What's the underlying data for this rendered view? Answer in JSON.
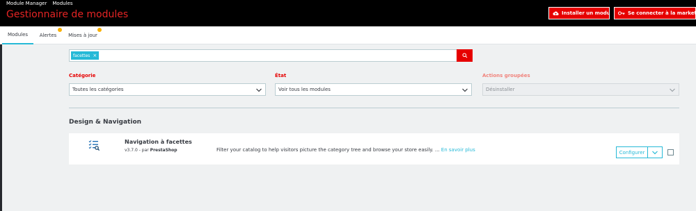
{
  "breadcrumb": {
    "items": [
      "Module Manager",
      "Modules"
    ]
  },
  "header": {
    "title": "Gestionnaire de modules",
    "install_label": "Installer un module",
    "connect_label": "Se connecter à la marketplace A"
  },
  "tabs": [
    {
      "label": "Modules",
      "active": true
    },
    {
      "label": "Alertes",
      "badge": true
    },
    {
      "label": "Mises à jour",
      "badge": true
    }
  ],
  "search": {
    "tag": "facettes",
    "tag_remove": "×"
  },
  "filters": {
    "category": {
      "label": "Catégorie",
      "value": "Toutes les catégories"
    },
    "state": {
      "label": "État",
      "value": "Voir tous les modules"
    },
    "bulk": {
      "label": "Actions groupées",
      "value": "Désinstaller"
    }
  },
  "section": {
    "title": "Design & Navigation"
  },
  "module": {
    "name": "Navigation à facettes",
    "version": "v3.7.0 - par",
    "author": "PrestaShop",
    "description": "Filter your catalog to help visitors picture the category tree and browse your store easily. ...",
    "more": "En savoir plus",
    "configure_label": "Configurer"
  },
  "colors": {
    "accent": "#25b9d7",
    "danger": "#e60000",
    "title_red": "#e62424",
    "badge": "#fab000"
  },
  "icons": [
    "cloud-upload-icon",
    "key-icon",
    "search-icon",
    "chevron-down-icon",
    "facet-module-icon",
    "close-icon"
  ]
}
